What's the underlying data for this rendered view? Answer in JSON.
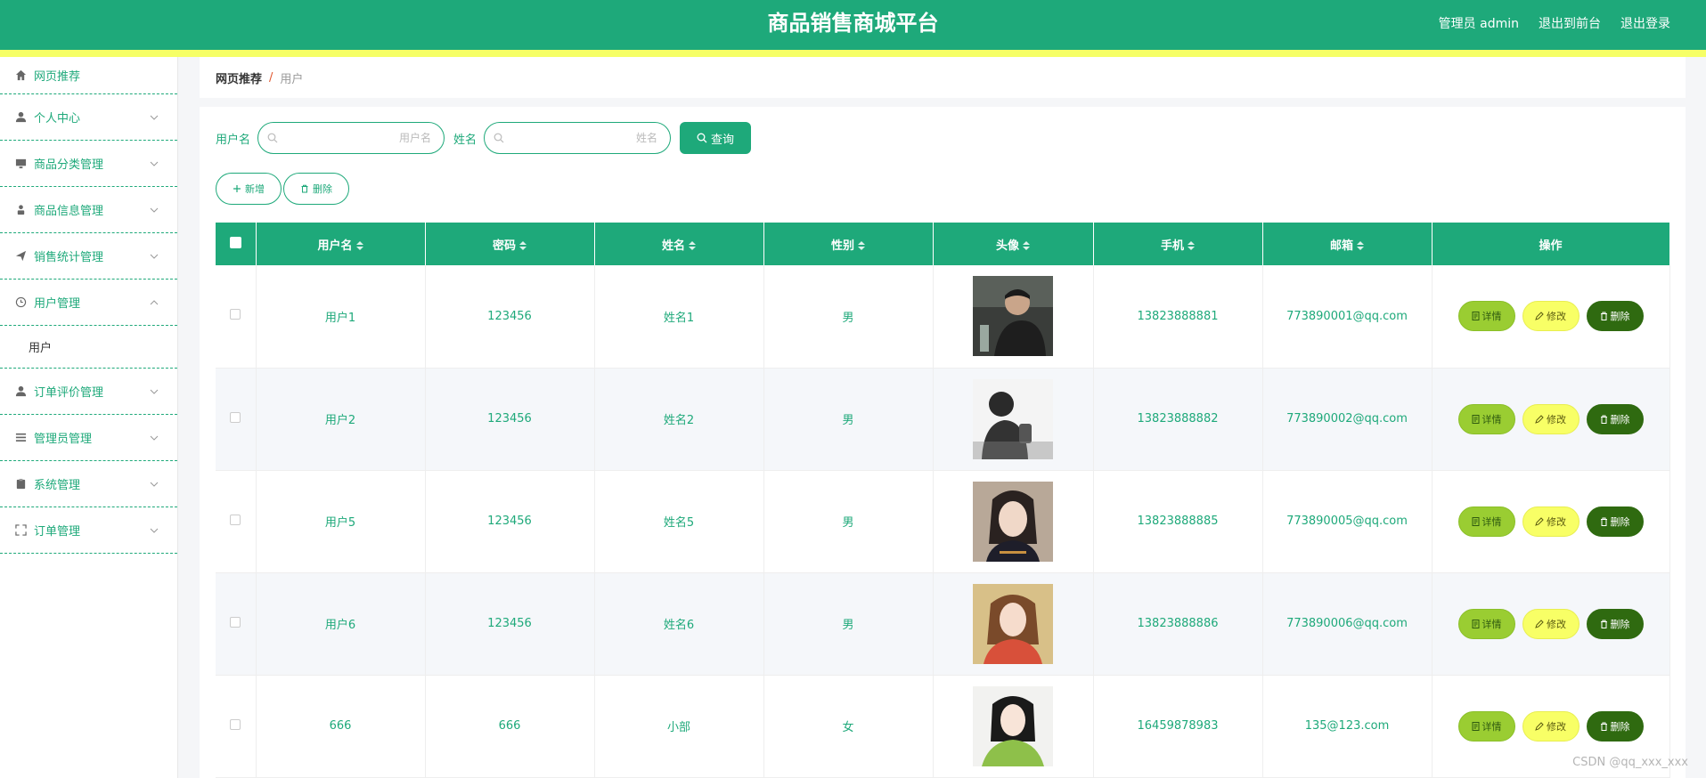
{
  "header": {
    "title": "商品销售商城平台",
    "user_label": "管理员 admin",
    "front_label": "退出到前台",
    "logout_label": "退出登录"
  },
  "sidebar": {
    "items": [
      {
        "label": "网页推荐",
        "icon": "home-icon"
      },
      {
        "label": "个人中心",
        "icon": "user-icon"
      },
      {
        "label": "商品分类管理",
        "icon": "monitor-icon"
      },
      {
        "label": "商品信息管理",
        "icon": "person-icon"
      },
      {
        "label": "销售统计管理",
        "icon": "send-icon"
      },
      {
        "label": "用户管理",
        "icon": "clock-icon"
      },
      {
        "label": "订单评价管理",
        "icon": "user-icon"
      },
      {
        "label": "管理员管理",
        "icon": "list-icon"
      },
      {
        "label": "系统管理",
        "icon": "clipboard-icon"
      },
      {
        "label": "订单管理",
        "icon": "fullscreen-icon"
      }
    ],
    "submenu_label": "用户"
  },
  "breadcrumb": {
    "home": "网页推荐",
    "separator": "/",
    "current": "用户"
  },
  "search": {
    "username_label": "用户名",
    "username_placeholder": "用户名",
    "name_label": "姓名",
    "name_placeholder": "姓名",
    "query_label": "查询"
  },
  "actions": {
    "add_label": "新增",
    "delete_label": "删除"
  },
  "table": {
    "headers": [
      "用户名",
      "密码",
      "姓名",
      "性别",
      "头像",
      "手机",
      "邮箱",
      "操作"
    ],
    "rows": [
      {
        "username": "用户1",
        "password": "123456",
        "name": "姓名1",
        "gender": "男",
        "phone": "13823888881",
        "email": "773890001@qq.com"
      },
      {
        "username": "用户2",
        "password": "123456",
        "name": "姓名2",
        "gender": "男",
        "phone": "13823888882",
        "email": "773890002@qq.com"
      },
      {
        "username": "用户5",
        "password": "123456",
        "name": "姓名5",
        "gender": "男",
        "phone": "13823888885",
        "email": "773890005@qq.com"
      },
      {
        "username": "用户6",
        "password": "123456",
        "name": "姓名6",
        "gender": "男",
        "phone": "13823888886",
        "email": "773890006@qq.com"
      },
      {
        "username": "666",
        "password": "666",
        "name": "小部",
        "gender": "女",
        "phone": "16459878983",
        "email": "135@123.com"
      }
    ],
    "op_detail": "详情",
    "op_edit": "修改",
    "op_delete": "删除"
  },
  "watermark": "CSDN @qq_xxx_xxx",
  "colors": {
    "primary": "#1ea97a",
    "stripe": "#f6ff66",
    "detail": "#9acd32",
    "edit": "#f8ff66",
    "delete": "#2f6a10"
  }
}
